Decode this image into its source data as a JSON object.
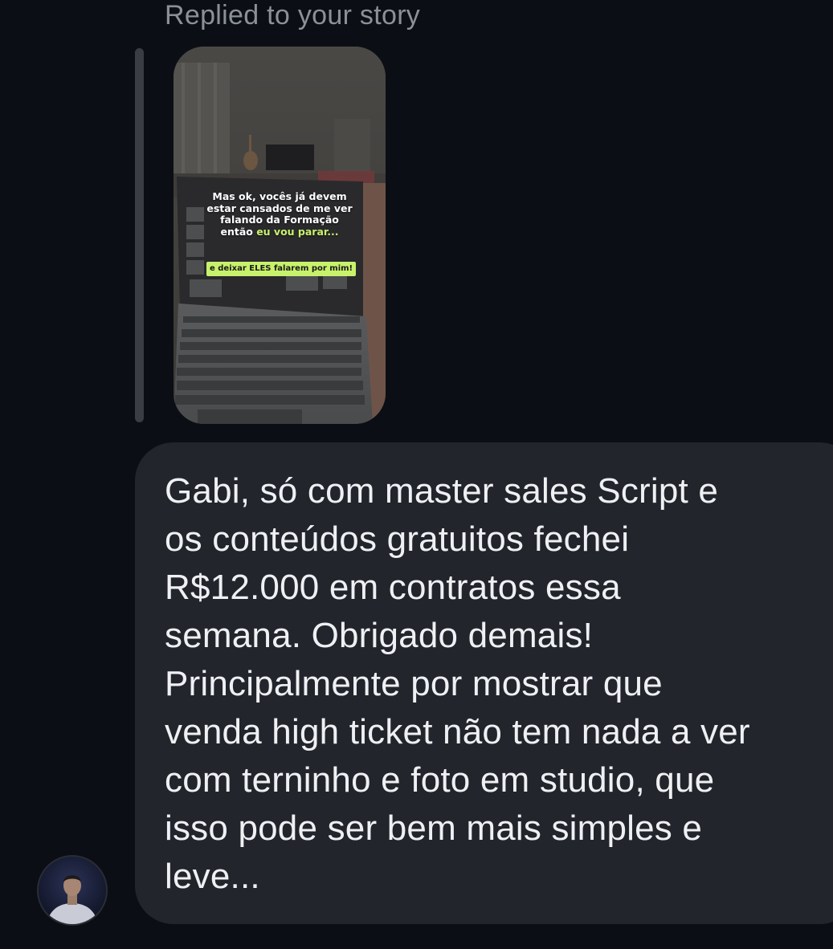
{
  "reply_context": {
    "label": "Replied to your story"
  },
  "story": {
    "overlay_line_1": "Mas ok, vocês já devem",
    "overlay_line_2": "estar cansados de me ver",
    "overlay_line_3": "falando da Formação",
    "overlay_line_4_prefix": "então ",
    "overlay_line_4_highlight": "eu vou parar...",
    "pill_text": "e deixar ELES falarem por mim!",
    "highlight_color": "#c8f26b"
  },
  "message": {
    "text": "Gabi, só com master sales Script e\nos conteúdos gratuitos fechei\nR$12.000 em contratos essa\nsemana. Obrigado demais!\nPrincipalmente por mostrar que\nvenda high ticket não tem nada a ver\ncom terninho e foto em studio, que\nisso pode ser bem mais simples e\nleve..."
  },
  "sender": {
    "avatar_icon": "profile-avatar"
  },
  "colors": {
    "background": "#0b0e14",
    "bubble": "#22252b",
    "label": "#8b9099",
    "text": "#eef0f3"
  }
}
